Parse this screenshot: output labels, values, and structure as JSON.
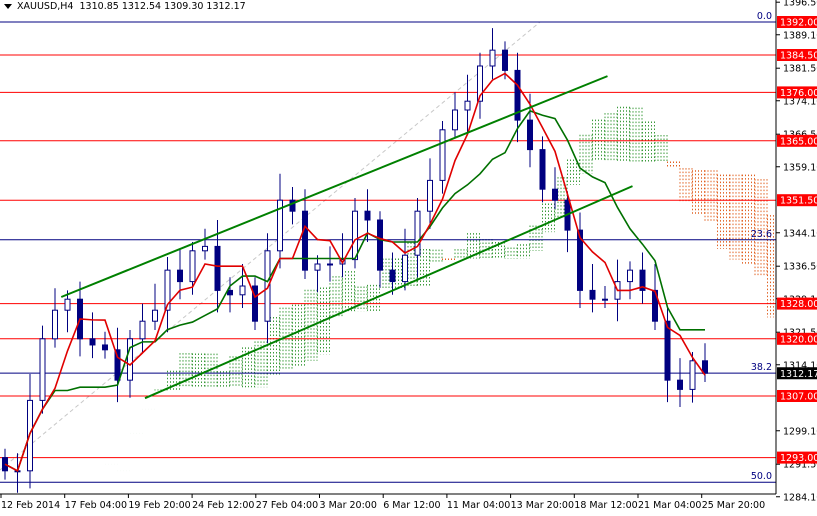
{
  "header": {
    "symbol": "XAUUSD,H4",
    "ohlc": "1310.85 1312.54 1309.30 1312.17"
  },
  "chart_data": {
    "type": "candlestick",
    "title": "XAUUSD,H4",
    "ylim": [
      1283.5,
      1397.0
    ],
    "y_ticks": [
      "1396.50",
      "1389.10",
      "1381.50",
      "1374.10",
      "1366.50",
      "1359.10",
      "1344.10",
      "1336.50",
      "1329.10",
      "1321.50",
      "1314.10",
      "1299.10",
      "1291.50",
      "1284.10"
    ],
    "x_labels": [
      "12 Feb 2014",
      "17 Feb 04:00",
      "19 Feb 20:00",
      "24 Feb 12:00",
      "27 Feb 04:00",
      "3 Mar 20:00",
      "6 Mar 12:00",
      "11 Mar 04:00",
      "13 Mar 20:00",
      "18 Mar 12:00",
      "21 Mar 04:00",
      "25 Mar 20:00"
    ],
    "closes": [
      1290,
      1290,
      1306,
      1320,
      1326.5,
      1329,
      1320,
      1318.6,
      1317.5,
      1310.6,
      1320,
      1324,
      1326.5,
      1335.6,
      1333,
      1340,
      1341,
      1331,
      1330,
      1332,
      1324,
      1340,
      1351.5,
      1349,
      1335.6,
      1337,
      1337,
      1338,
      1349,
      1347,
      1335.6,
      1333,
      1339,
      1349,
      1356,
      1367.5,
      1372,
      1374,
      1382,
      1385.6,
      1381,
      1369.7,
      1363,
      1354,
      1351.5,
      1344.7,
      1331,
      1329,
      1329,
      1333,
      1335.6,
      1331,
      1324,
      1310.6,
      1308.5,
      1315,
      1312.17
    ],
    "first_open": 1293,
    "last_price": "1312.17",
    "levels": [
      {
        "price": 1384.5,
        "label": "1384.50"
      },
      {
        "price": 1376.0,
        "label": "1376.00"
      },
      {
        "price": 1365.0,
        "label": "1365.00"
      },
      {
        "price": 1351.5,
        "label": "1351.50"
      },
      {
        "price": 1328.0,
        "label": "1328.00"
      },
      {
        "price": 1320.0,
        "label": "1320.00"
      },
      {
        "price": 1307.0,
        "label": "1307.00"
      },
      {
        "price": 1293.0,
        "label": "1293.00"
      },
      {
        "price": 1392.0,
        "label": "1392.00"
      }
    ],
    "fibonacci": [
      {
        "level": "0.0",
        "price": 1392.0
      },
      {
        "level": "23.6",
        "price": 1342.5
      },
      {
        "level": "38.2",
        "price": 1312.2
      },
      {
        "level": "50.0",
        "price": 1287.4
      }
    ],
    "trendlines": [
      {
        "name": "channel-upper",
        "from": [
          4.5,
          1329.5
        ],
        "to": [
          48.2,
          1379.7
        ]
      },
      {
        "name": "channel-lower",
        "from": [
          11.2,
          1306.5
        ],
        "to": [
          50.2,
          1354.7
        ]
      }
    ],
    "ichimoku": {
      "tenkan": 3,
      "kijun": 8,
      "senkou_b": 16,
      "shift": 8
    },
    "colors": {
      "level": "#ff0000",
      "fib": "#000080",
      "trend": "#008000",
      "tenkan": "#e00000",
      "kijun": "#007000",
      "cloud_up": "#3a9a3a",
      "cloud_down": "#e06020",
      "candle": "#000080",
      "current": "#000000"
    }
  }
}
